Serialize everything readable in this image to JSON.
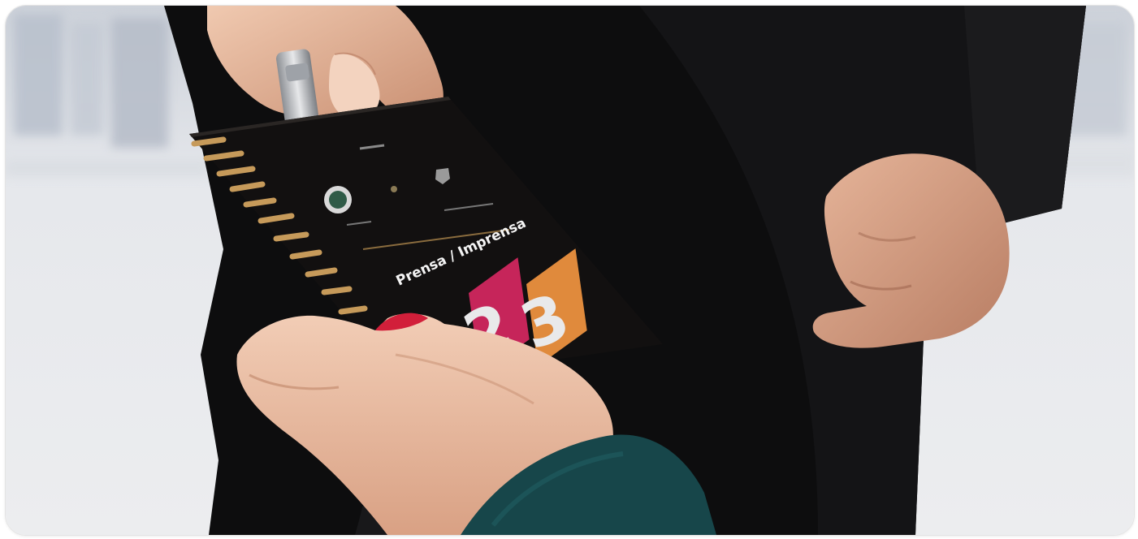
{
  "photo": {
    "card": {
      "heading": "Prensa / Imprensa",
      "digit_left": "2",
      "digit_right": "3"
    },
    "colors": {
      "badge_background": "#121010",
      "accent_magenta": "#c6255a",
      "accent_orange": "#e08a3c",
      "jacket_teal": "#17464a",
      "nail_red": "#d21f3a",
      "clothing_black": "#0c0c0d",
      "background_light": "#e9ebee"
    }
  }
}
